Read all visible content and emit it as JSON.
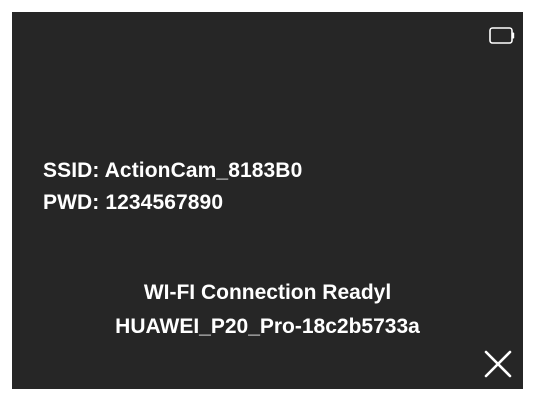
{
  "status_bar": {
    "battery_icon": "battery-icon"
  },
  "credentials": {
    "ssid_label": "SSID:",
    "ssid_value": "ActionCam_8183B0",
    "pwd_label": "PWD:",
    "pwd_value": "1234567890"
  },
  "connection": {
    "status_text": "WI-FI Connection Readyl",
    "device_name": "HUAWEI_P20_Pro-18c2b5733a"
  },
  "controls": {
    "close_icon": "close-icon"
  },
  "colors": {
    "background": "#262626",
    "text": "#ffffff"
  }
}
